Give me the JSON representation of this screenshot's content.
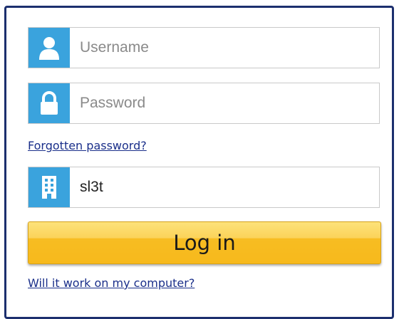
{
  "login_form": {
    "username": {
      "icon": "user-icon",
      "value": "",
      "placeholder": "Username"
    },
    "password": {
      "icon": "lock-icon",
      "value": "",
      "placeholder": "Password"
    },
    "forgotten_password_link": "Forgotten password?",
    "organisation": {
      "icon": "building-icon",
      "value": "sl3t",
      "placeholder": ""
    },
    "login_button": "Log in",
    "compatibility_link": "Will it work on my computer?"
  },
  "colors": {
    "frame_border": "#1c2f6e",
    "icon_background": "#3aa3dd",
    "button_yellow": "#f7b91c",
    "link": "#1a2f8a"
  }
}
